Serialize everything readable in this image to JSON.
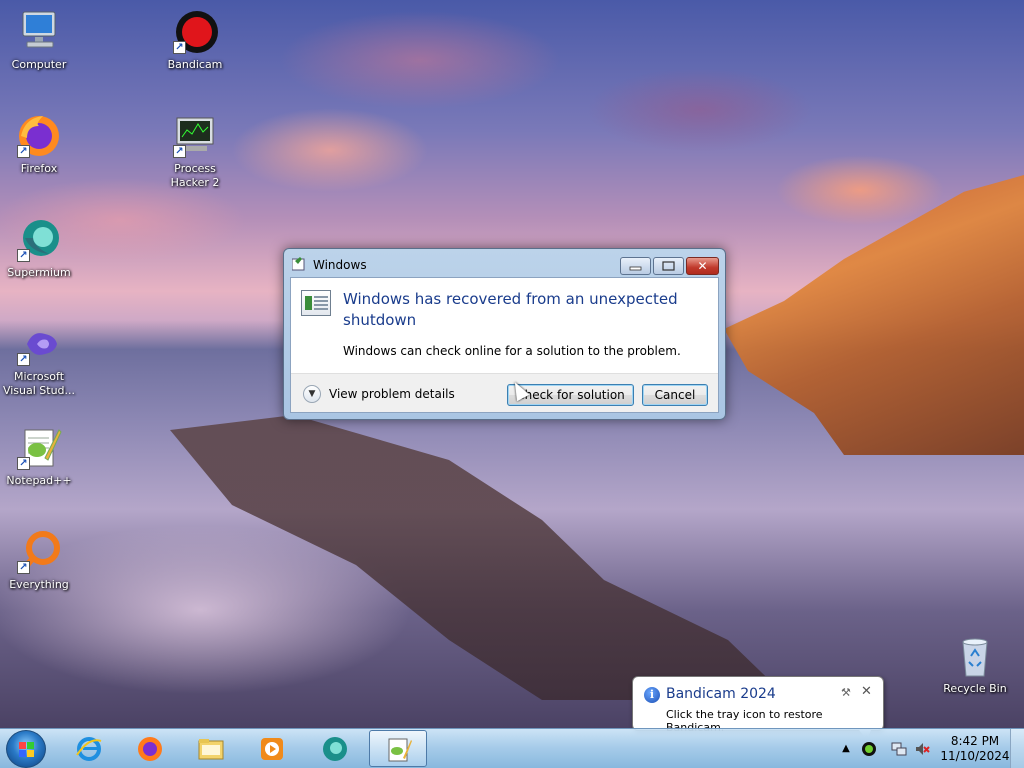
{
  "desktop": {
    "icons": [
      {
        "label": "Computer",
        "icon": "computer-icon"
      },
      {
        "label": "Bandicam",
        "icon": "bandicam-icon"
      },
      {
        "label": "Firefox",
        "icon": "firefox-icon"
      },
      {
        "label": "Process Hacker 2",
        "icon": "process-hacker-icon"
      },
      {
        "label": "Supermium",
        "icon": "supermium-icon"
      },
      {
        "label": "Microsoft Visual Stud...",
        "icon": "visual-studio-icon"
      },
      {
        "label": "Notepad++",
        "icon": "notepadpp-icon"
      },
      {
        "label": "Everything",
        "icon": "everything-icon"
      },
      {
        "label": "Recycle Bin",
        "icon": "recycle-bin-icon"
      }
    ]
  },
  "dialog": {
    "title": "Windows",
    "main_instruction": "Windows has recovered from an unexpected shutdown",
    "content": "Windows can check online for a solution to the problem.",
    "expander_label": "View problem details",
    "primary_button": "Check for solution",
    "cancel_button": "Cancel",
    "caption_buttons": {
      "minimize": "minimize-icon",
      "maximize": "maximize-icon",
      "close": "close-icon"
    }
  },
  "notification": {
    "title": "Bandicam 2024",
    "text": "Click the tray icon to restore Bandicam.",
    "close_glyph": "✕"
  },
  "taskbar": {
    "pinned": [
      "internet-explorer-icon",
      "firefox-icon",
      "file-explorer-icon",
      "media-player-icon",
      "supermium-icon",
      "notepadpp-icon"
    ],
    "active_item": "notepadpp-icon",
    "tray": [
      "show-hidden-icons-icon",
      "bandicam-tray-icon",
      "network-icon",
      "volume-muted-icon"
    ],
    "clock": {
      "time": "8:42 PM",
      "date": "11/10/2024"
    }
  },
  "colors": {
    "instruction_blue": "#1a3c8c",
    "close_red": "#c0392b",
    "taskbar": "#a0c8e8"
  }
}
